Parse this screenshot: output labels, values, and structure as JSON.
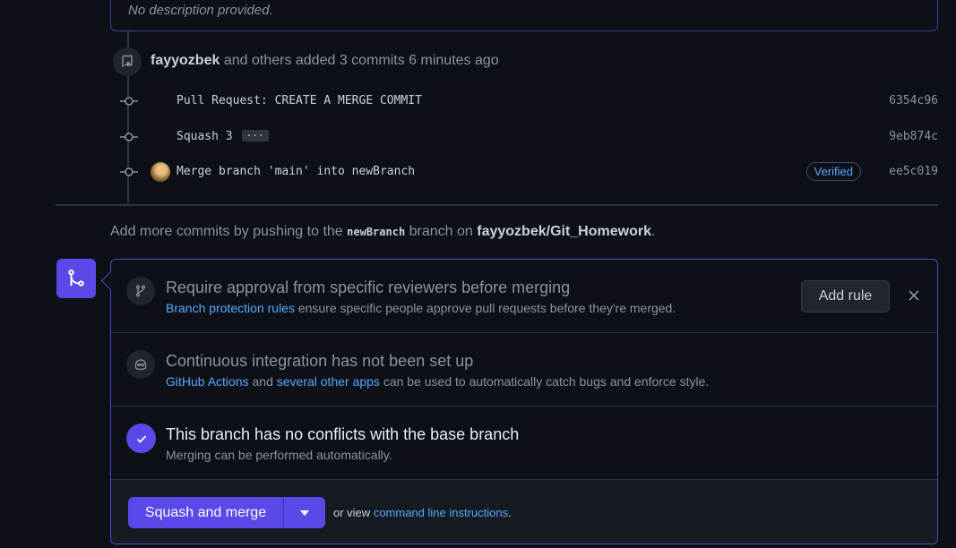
{
  "description": {
    "text": "No description provided."
  },
  "push_event": {
    "author": "fayyozbek",
    "rest": "and others added 3 commits 6 minutes ago"
  },
  "commits": [
    {
      "message": "Pull Request: CREATE A MERGE COMMIT",
      "sha": "6354c96"
    },
    {
      "message": "Squash 3",
      "ellipsis": "···",
      "sha": "9eb874c"
    },
    {
      "message": "Merge branch 'main' into newBranch",
      "verified": "Verified",
      "sha": "ee5c019"
    }
  ],
  "add_more": {
    "prefix": "Add more commits by pushing to the",
    "branch": "newBranch",
    "middle": "branch on",
    "repo": "fayyozbek/Git_Homework",
    "suffix": "."
  },
  "merge": {
    "reviewers": {
      "title": "Require approval from specific reviewers before merging",
      "link": "Branch protection rules",
      "rest": "ensure specific people approve pull requests before they're merged.",
      "add_rule": "Add rule"
    },
    "ci": {
      "title": "Continuous integration has not been set up",
      "link1": "GitHub Actions",
      "and": "and",
      "link2": "several other apps",
      "rest": "can be used to automatically catch bugs and enforce style."
    },
    "conflicts": {
      "title": "This branch has no conflicts with the base branch",
      "sub": "Merging can be performed automatically."
    },
    "footer": {
      "button": "Squash and merge",
      "or_view": "or view",
      "link": "command line instructions",
      "period": "."
    }
  },
  "colors": {
    "accent": "#5a48e8",
    "link": "#58a6ff",
    "background": "#0d1117"
  }
}
